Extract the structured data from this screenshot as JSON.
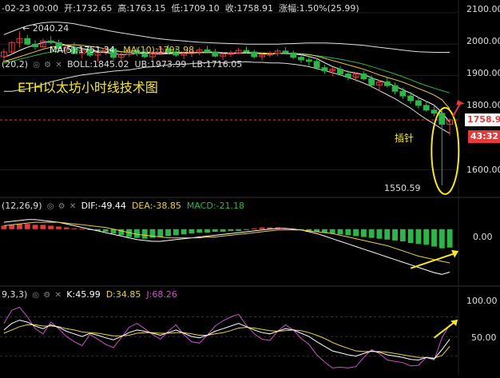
{
  "header": {
    "date": "-02-23 00:00",
    "open": "开:1732.65",
    "high": "高:1763.15",
    "low": "低:1709.10",
    "close": "收:1758.91",
    "change": "涨幅:1.50%(25.99)"
  },
  "main": {
    "ma5": "MA(5):1751.34",
    "ma10": "MA(10):1793.98",
    "boll_params": "(20,2)",
    "boll": "BOLL:1845.02",
    "ub": "UB:1973.99",
    "lb": "LB:1716.05",
    "title": "ETH以太坊小时线技术图",
    "high_mark": "2040.24",
    "low_mark": "1550.59",
    "wick_label": "插针",
    "price_badge": "1758.91",
    "timer_badge": "43:32",
    "axis": [
      "2100.00",
      "2000.00",
      "1900.00",
      "1800.00",
      "1600.00"
    ]
  },
  "macd": {
    "params": "(12,26,9)",
    "dif": "DIF:-49.44",
    "dea": "DEA:-38.85",
    "macd": "MACD:-21.18",
    "axis": [
      "0.00"
    ]
  },
  "kdj": {
    "params": "9,3,3)",
    "k": "K:45.99",
    "d": "D:34.85",
    "j": "J:68.26",
    "axis": [
      "100.00",
      "50.00"
    ]
  },
  "colors": {
    "up": "#e33b3b",
    "down": "#2fb44a",
    "ma5": "#ffffff",
    "ma10": "#e8d23a",
    "boll_mid": "#2fb44a",
    "boll_band": "#dddddd",
    "title": "#f5e62a",
    "k": "#ffffff",
    "d": "#e8d23a",
    "j": "#c855c8",
    "price_badge": "#e33b3b",
    "annotation": "#f5e62a"
  },
  "chart_data": [
    {
      "type": "candlestick",
      "title": "ETH以太坊小时线技术图",
      "ylim": [
        1530,
        2110
      ],
      "ohlc": [
        [
          1960,
          1985,
          1948,
          1975
        ],
        [
          1975,
          2010,
          1968,
          2005
        ],
        [
          2005,
          2040.24,
          1990,
          2018
        ],
        [
          2018,
          2030,
          1996,
          2000
        ],
        [
          2000,
          2012,
          1982,
          1992
        ],
        [
          1992,
          2018,
          1988,
          2010
        ],
        [
          2010,
          2025,
          2000,
          2005
        ],
        [
          2005,
          2014,
          1978,
          1985
        ],
        [
          1985,
          1995,
          1968,
          1990
        ],
        [
          1990,
          2005,
          1980,
          1970
        ],
        [
          1970,
          1985,
          1955,
          1980
        ],
        [
          1980,
          1992,
          1960,
          1965
        ],
        [
          1965,
          1980,
          1945,
          1975
        ],
        [
          1975,
          1990,
          1965,
          1985
        ],
        [
          1985,
          1995,
          1950,
          1958
        ],
        [
          1958,
          1975,
          1940,
          1968
        ],
        [
          1968,
          1985,
          1960,
          1980
        ],
        [
          1980,
          1990,
          1962,
          1970
        ],
        [
          1970,
          1985,
          1955,
          1960
        ],
        [
          1960,
          1978,
          1948,
          1972
        ],
        [
          1972,
          1990,
          1965,
          1985
        ],
        [
          1985,
          1998,
          1968,
          1975
        ],
        [
          1975,
          1988,
          1960,
          1965
        ],
        [
          1965,
          1978,
          1952,
          1970
        ],
        [
          1970,
          1982,
          1960,
          1975
        ],
        [
          1975,
          1990,
          1965,
          1982
        ],
        [
          1982,
          1995,
          1970,
          1975
        ],
        [
          1975,
          1985,
          1958,
          1962
        ],
        [
          1962,
          1975,
          1950,
          1968
        ],
        [
          1968,
          1980,
          1960,
          1972
        ],
        [
          1972,
          1988,
          1968,
          1980
        ],
        [
          1980,
          1992,
          1970,
          1975
        ],
        [
          1975,
          1982,
          1955,
          1960
        ],
        [
          1960,
          1972,
          1948,
          1965
        ],
        [
          1965,
          1978,
          1958,
          1970
        ],
        [
          1970,
          1985,
          1962,
          1978
        ],
        [
          1978,
          1990,
          1968,
          1972
        ],
        [
          1972,
          1980,
          1952,
          1958
        ],
        [
          1958,
          1968,
          1940,
          1950
        ],
        [
          1950,
          1962,
          1930,
          1945
        ],
        [
          1945,
          1955,
          1920,
          1925
        ],
        [
          1925,
          1935,
          1905,
          1915
        ],
        [
          1915,
          1928,
          1898,
          1920
        ],
        [
          1920,
          1930,
          1900,
          1905
        ],
        [
          1905,
          1918,
          1885,
          1895
        ],
        [
          1895,
          1910,
          1880,
          1905
        ],
        [
          1905,
          1915,
          1885,
          1890
        ],
        [
          1890,
          1900,
          1860,
          1870
        ],
        [
          1870,
          1885,
          1850,
          1880
        ],
        [
          1880,
          1892,
          1862,
          1868
        ],
        [
          1868,
          1878,
          1840,
          1850
        ],
        [
          1850,
          1862,
          1825,
          1835
        ],
        [
          1835,
          1848,
          1810,
          1820
        ],
        [
          1820,
          1832,
          1795,
          1805
        ],
        [
          1805,
          1820,
          1785,
          1790
        ],
        [
          1790,
          1802,
          1770,
          1780
        ],
        [
          1780,
          1790,
          1550.59,
          1745
        ],
        [
          1745,
          1763.15,
          1709.1,
          1758.91
        ]
      ],
      "ma5": [
        1958,
        1968,
        1980,
        1990,
        1998,
        2005,
        2008,
        2004,
        1996,
        1991,
        1986,
        1982,
        1976,
        1973,
        1971,
        1966,
        1968,
        1970,
        1972,
        1970,
        1969,
        1972,
        1973,
        1973,
        1973,
        1974,
        1975,
        1975,
        1971,
        1970,
        1971,
        1973,
        1972,
        1969,
        1968,
        1970,
        1971,
        1969,
        1966,
        1961,
        1954,
        1941,
        1929,
        1920,
        1912,
        1908,
        1903,
        1893,
        1884,
        1877,
        1866,
        1855,
        1844,
        1830,
        1818,
        1806,
        1782,
        1751.34
      ],
      "ma10": [
        1945,
        1952,
        1960,
        1968,
        1976,
        1984,
        1990,
        1995,
        1997,
        1998,
        1996,
        1993,
        1990,
        1985,
        1981,
        1976,
        1974,
        1972,
        1972,
        1971,
        1969,
        1969,
        1970,
        1971,
        1972,
        1973,
        1973,
        1974,
        1973,
        1972,
        1972,
        1972,
        1972,
        1972,
        1971,
        1970,
        1970,
        1970,
        1969,
        1967,
        1962,
        1955,
        1948,
        1941,
        1934,
        1927,
        1920,
        1911,
        1902,
        1894,
        1887,
        1879,
        1869,
        1859,
        1849,
        1838,
        1823,
        1793.98
      ],
      "boll_mid": [
        1940,
        1945,
        1952,
        1958,
        1964,
        1970,
        1975,
        1978,
        1980,
        1981,
        1981,
        1980,
        1979,
        1978,
        1977,
        1976,
        1975,
        1975,
        1975,
        1974,
        1974,
        1974,
        1974,
        1973,
        1973,
        1973,
        1973,
        1973,
        1972,
        1972,
        1972,
        1972,
        1971,
        1971,
        1970,
        1970,
        1970,
        1969,
        1968,
        1966,
        1963,
        1960,
        1956,
        1952,
        1947,
        1942,
        1936,
        1929,
        1921,
        1913,
        1905,
        1896,
        1887,
        1877,
        1868,
        1860,
        1852,
        1845.02
      ],
      "ub": [
        2030,
        2040,
        2050,
        2058,
        2064,
        2068,
        2070,
        2070,
        2068,
        2065,
        2060,
        2055,
        2050,
        2045,
        2040,
        2036,
        2032,
        2028,
        2024,
        2020,
        2017,
        2014,
        2012,
        2010,
        2008,
        2006,
        2005,
        2004,
        2003,
        2002,
        2001,
        2000,
        2000,
        2000,
        2000,
        2000,
        2001,
        2002,
        2003,
        2004,
        2004,
        2004,
        2003,
        2002,
        2000,
        1998,
        1996,
        1993,
        1990,
        1987,
        1984,
        1981,
        1978,
        1976,
        1975,
        1974,
        1974,
        1973.99
      ],
      "lb": [
        1850,
        1850,
        1854,
        1858,
        1864,
        1872,
        1880,
        1886,
        1892,
        1897,
        1902,
        1905,
        1908,
        1911,
        1914,
        1916,
        1918,
        1922,
        1926,
        1928,
        1931,
        1934,
        1936,
        1936,
        1938,
        1940,
        1941,
        1942,
        1941,
        1942,
        1943,
        1944,
        1942,
        1942,
        1940,
        1940,
        1939,
        1936,
        1933,
        1928,
        1922,
        1916,
        1909,
        1902,
        1894,
        1886,
        1876,
        1865,
        1852,
        1839,
        1826,
        1811,
        1796,
        1778,
        1761,
        1746,
        1730,
        1716.05
      ]
    },
    {
      "type": "bar",
      "title": "MACD",
      "ylim": [
        -60,
        20
      ],
      "macd": [
        4,
        5,
        6,
        6,
        5,
        5,
        4,
        3,
        2,
        1,
        0.5,
        -1,
        -2,
        -3,
        -5,
        -7,
        -9,
        -10,
        -11,
        -10,
        -9,
        -8,
        -7,
        -6,
        -5,
        -4,
        -4,
        -3,
        -3,
        -2,
        -2,
        -1,
        1,
        2,
        2,
        2,
        1,
        0.5,
        -1,
        -2,
        -3,
        -4,
        -5,
        -6,
        -7,
        -8,
        -9,
        -10,
        -11,
        -12,
        -13,
        -14,
        -16,
        -17,
        -18,
        -20,
        -22,
        -21.18
      ],
      "dif": [
        8,
        9,
        10,
        11,
        11,
        10,
        9,
        8,
        6,
        4,
        2,
        0,
        -2,
        -4,
        -6,
        -8,
        -10,
        -12,
        -13,
        -14,
        -14,
        -13,
        -12,
        -11,
        -10,
        -9,
        -8,
        -7,
        -6,
        -5,
        -4,
        -3,
        -2,
        -1,
        0,
        1,
        1,
        0,
        -1,
        -3,
        -5,
        -8,
        -11,
        -14,
        -17,
        -20,
        -23,
        -26,
        -29,
        -32,
        -35,
        -38,
        -41,
        -44,
        -47,
        -50,
        -52,
        -49.44
      ],
      "dea": [
        4,
        5,
        6,
        7,
        8,
        8,
        8,
        8,
        7,
        6,
        5,
        4,
        3,
        2,
        0,
        -2,
        -4,
        -6,
        -7,
        -8,
        -9,
        -10,
        -10,
        -10,
        -10,
        -10,
        -9,
        -9,
        -8,
        -7,
        -6,
        -5,
        -4,
        -3,
        -2,
        -1,
        -1,
        -1,
        -1,
        -2,
        -3,
        -4,
        -5,
        -7,
        -9,
        -11,
        -13,
        -15,
        -17,
        -19,
        -22,
        -25,
        -28,
        -31,
        -33,
        -35,
        -37,
        -38.85
      ]
    },
    {
      "type": "line",
      "title": "KDJ",
      "ylim": [
        0,
        110
      ],
      "k": [
        60,
        70,
        75,
        72,
        66,
        62,
        68,
        64,
        58,
        54,
        50,
        55,
        52,
        48,
        45,
        50,
        56,
        60,
        58,
        55,
        52,
        56,
        60,
        55,
        50,
        48,
        52,
        58,
        62,
        66,
        70,
        65,
        60,
        56,
        54,
        58,
        62,
        60,
        55,
        50,
        42,
        35,
        28,
        25,
        22,
        20,
        24,
        28,
        26,
        22,
        20,
        18,
        15,
        14,
        18,
        16,
        30,
        45.99
      ],
      "d": [
        55,
        60,
        65,
        68,
        68,
        66,
        66,
        65,
        62,
        60,
        57,
        56,
        55,
        53,
        51,
        51,
        52,
        55,
        56,
        56,
        55,
        55,
        56,
        56,
        54,
        52,
        52,
        54,
        56,
        59,
        63,
        64,
        63,
        61,
        59,
        58,
        59,
        60,
        59,
        56,
        52,
        47,
        41,
        36,
        32,
        28,
        27,
        27,
        27,
        26,
        24,
        22,
        20,
        18,
        18,
        17,
        21,
        34.85
      ],
      "j": [
        70,
        90,
        95,
        80,
        62,
        54,
        72,
        62,
        50,
        42,
        36,
        53,
        46,
        38,
        33,
        48,
        64,
        70,
        62,
        53,
        46,
        58,
        68,
        53,
        42,
        40,
        52,
        66,
        74,
        80,
        84,
        67,
        54,
        46,
        44,
        58,
        68,
        60,
        47,
        38,
        22,
        11,
        2,
        3,
        2,
        4,
        18,
        30,
        24,
        14,
        12,
        10,
        5,
        6,
        18,
        14,
        48,
        68.26
      ]
    }
  ]
}
